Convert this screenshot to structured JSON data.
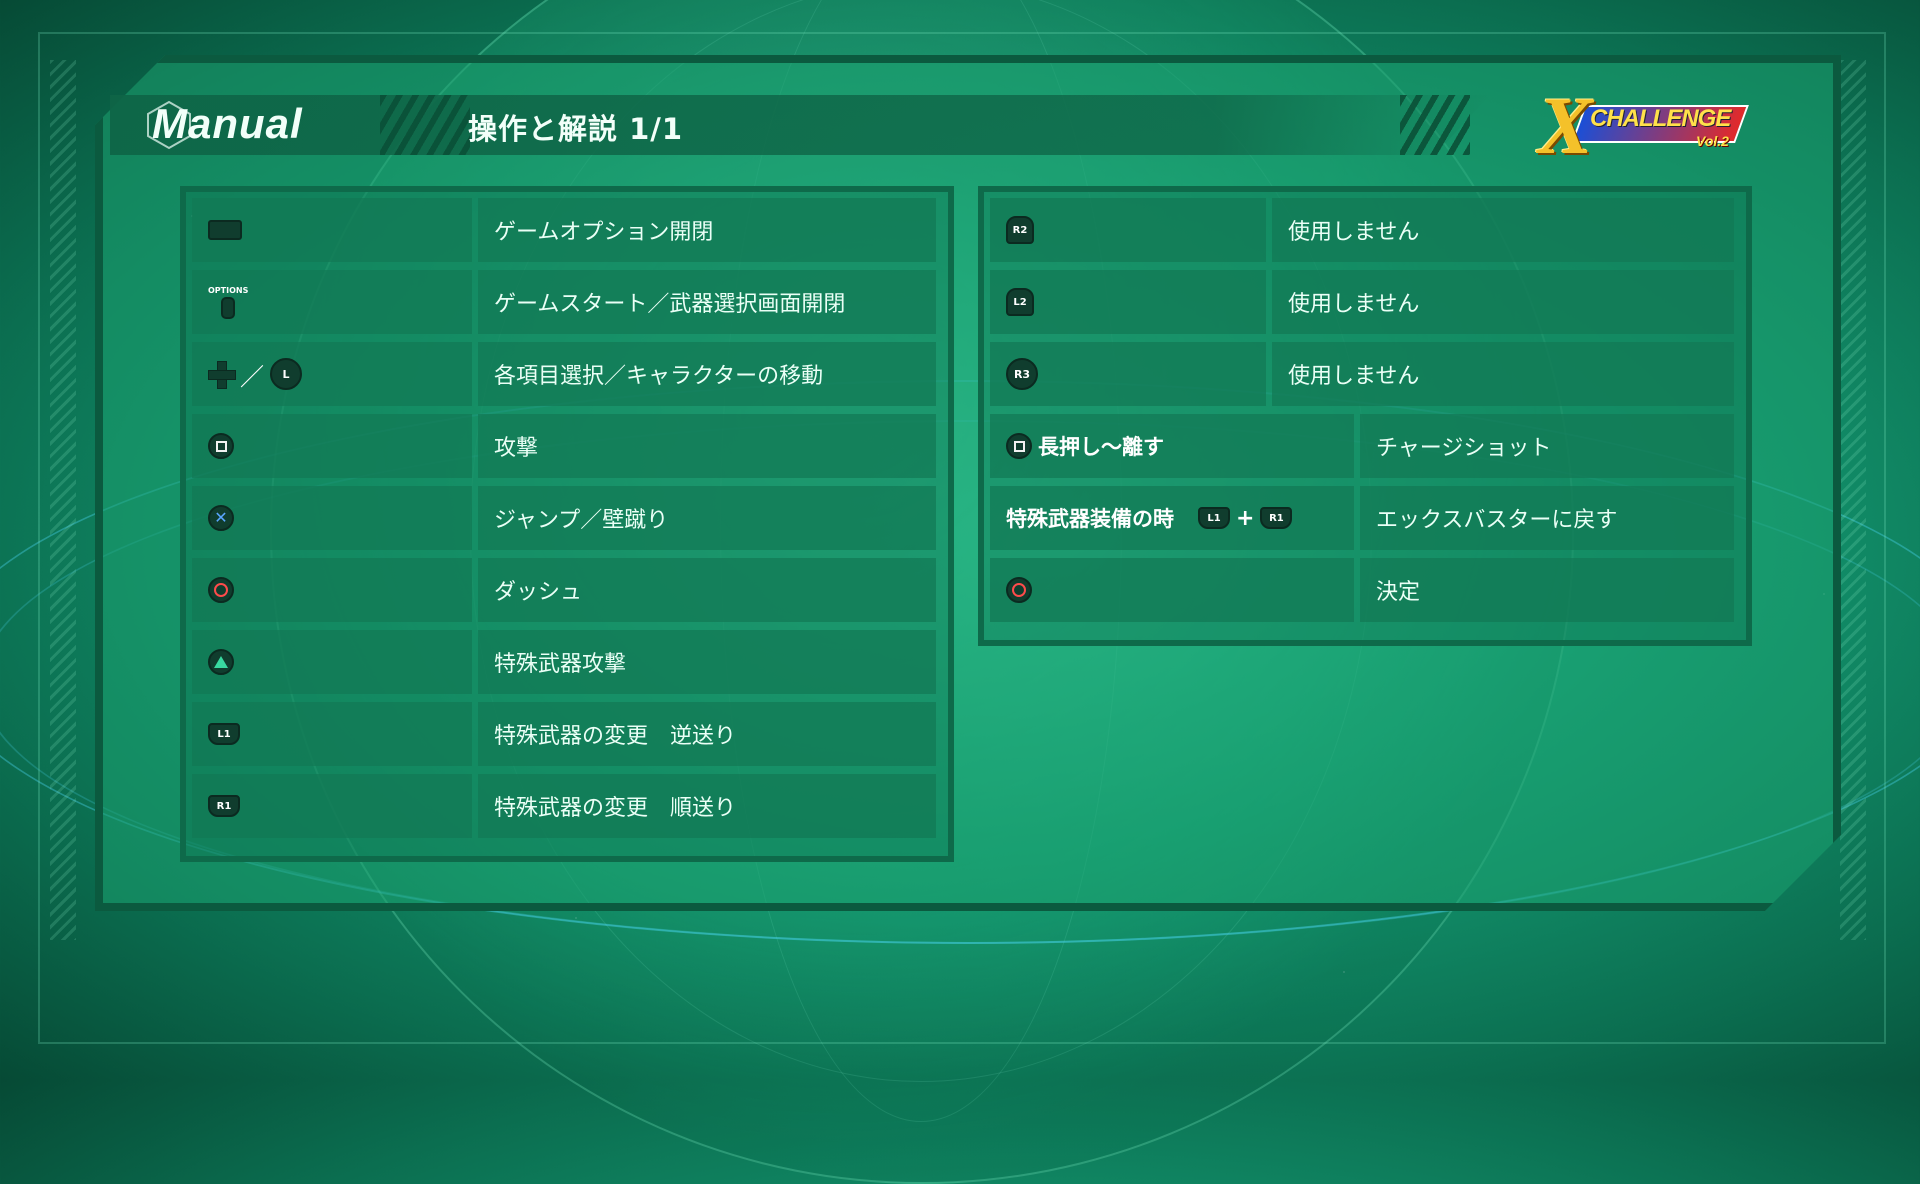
{
  "header": {
    "manual_label": "Manual",
    "title": "操作と解説 1/1"
  },
  "logo": {
    "x": "X",
    "challenge": "CHALLENGE",
    "vol": "Vol.2"
  },
  "left_table": [
    {
      "icon": "touchpad-icon",
      "label": "ゲームオプション開閉"
    },
    {
      "icon": "options-button-icon",
      "icon_text": "OPTIONS",
      "label": "ゲームスタート／武器選択画面開閉"
    },
    {
      "icon": "dpad-or-left-stick-icon",
      "icon_text": "L",
      "label": "各項目選択／キャラクターの移動"
    },
    {
      "icon": "square-button-icon",
      "label": "攻撃"
    },
    {
      "icon": "cross-button-icon",
      "label": "ジャンプ／壁蹴り"
    },
    {
      "icon": "circle-button-icon",
      "label": "ダッシュ"
    },
    {
      "icon": "triangle-button-icon",
      "label": "特殊武器攻撃"
    },
    {
      "icon": "l1-button-icon",
      "icon_text": "L1",
      "label": "特殊武器の変更　逆送り"
    },
    {
      "icon": "r1-button-icon",
      "icon_text": "R1",
      "label": "特殊武器の変更　順送り"
    }
  ],
  "right_table": [
    {
      "icon": "r2-button-icon",
      "icon_text": "R2",
      "label": "使用しません"
    },
    {
      "icon": "l2-button-icon",
      "icon_text": "L2",
      "label": "使用しません"
    },
    {
      "icon": "r3-button-icon",
      "icon_text": "R3",
      "label": "使用しません"
    },
    {
      "icon": "square-button-icon",
      "condition": "長押し〜離す",
      "label": "チャージショット"
    },
    {
      "condition": "特殊武器装備の時",
      "combo": [
        "L1",
        "+",
        "R1"
      ],
      "label": "エックスバスターに戻す"
    },
    {
      "icon": "circle-button-icon",
      "label": "決定"
    }
  ],
  "colors": {
    "background": "#149a72",
    "panel": "#1ca070",
    "cell": "#12785a",
    "border": "#0b5a3f",
    "text": "#eafff6",
    "circle": "#ff4b4b",
    "cross": "#5aa6ff",
    "triangle": "#38d9a0"
  }
}
